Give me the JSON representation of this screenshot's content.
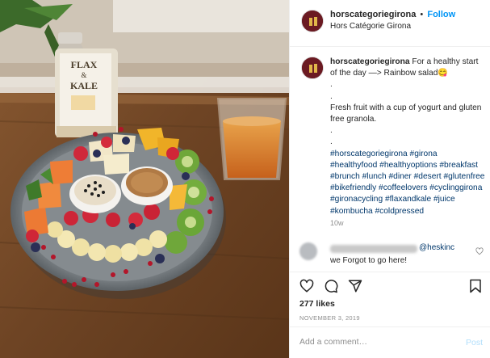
{
  "photo": {
    "bottle_label_top": "FLAX",
    "bottle_label_amp": "&",
    "bottle_label_bottom": "KALE"
  },
  "header": {
    "username": "horscategoriegirona",
    "separator": "•",
    "follow_label": "Follow",
    "location": "Hors Catégorie Girona"
  },
  "caption": {
    "username": "horscategoriegirona",
    "line1": "For a healthy start of the day —> Rainbow salad😋",
    "line2": "Fresh fruit with a cup of yogurt and gluten free granola.",
    "hashtags": "#horscategoriegirona #girona #healthyfood #healthyoptions #breakfast #brunch #lunch #diner #desert #glutenfree #bikefriendly #coffeelovers #cyclinggirona #gironacycling #flaxandkale #juice #kombucha #coldpressed",
    "time": "10w"
  },
  "comment": {
    "mention": "@heskinc",
    "text": "we Forgot to go here!"
  },
  "actions": {
    "likes": "277 likes",
    "date": "NOVEMBER 3, 2019"
  },
  "add_comment": {
    "placeholder": "Add a comment…",
    "post_label": "Post"
  },
  "colors": {
    "follow": "#0095f6",
    "hashtag": "#00376b",
    "post_disabled": "#b2dffc",
    "avatar_bg": "#6b1a22"
  }
}
